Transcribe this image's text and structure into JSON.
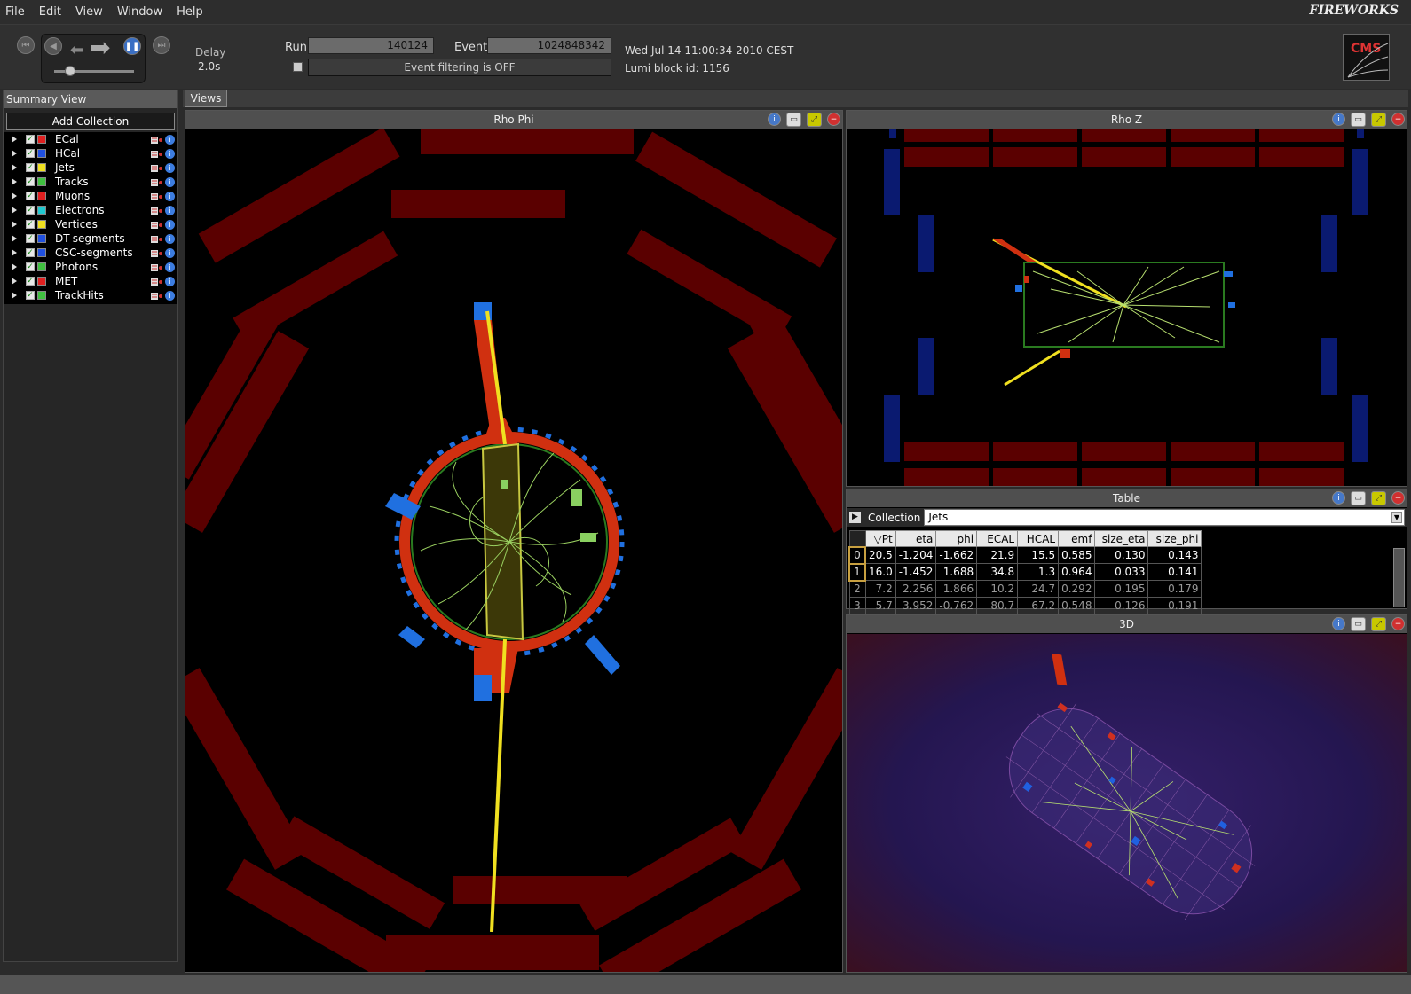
{
  "menu": [
    "File",
    "Edit",
    "View",
    "Window",
    "Help"
  ],
  "brand": "FIREWORKS",
  "toolbar": {
    "delay_label": "Delay",
    "delay_value": "2.0s",
    "run_label": "Run",
    "run_value": "140124",
    "event_label": "Event",
    "event_value": "1024848342",
    "filter_text": "Event filtering is OFF",
    "datetime": "Wed Jul 14 11:00:34 2010 CEST",
    "lumi": "Lumi block id: 1156",
    "cms_logo": "CMS"
  },
  "summary": {
    "title": "Summary View",
    "add_button": "Add Collection",
    "collections": [
      {
        "name": "ECal",
        "color": "#e02020"
      },
      {
        "name": "HCal",
        "color": "#2050e0"
      },
      {
        "name": "Jets",
        "color": "#f0e020"
      },
      {
        "name": "Tracks",
        "color": "#40c040"
      },
      {
        "name": "Muons",
        "color": "#e02020"
      },
      {
        "name": "Electrons",
        "color": "#20c8d0"
      },
      {
        "name": "Vertices",
        "color": "#f0e020"
      },
      {
        "name": "DT-segments",
        "color": "#2050e0"
      },
      {
        "name": "CSC-segments",
        "color": "#2050e0"
      },
      {
        "name": "Photons",
        "color": "#40c040"
      },
      {
        "name": "MET",
        "color": "#e02020"
      },
      {
        "name": "TrackHits",
        "color": "#40c040"
      }
    ]
  },
  "views_tab": "Views",
  "panels": {
    "rhophi": "Rho Phi",
    "rhoz": "Rho Z",
    "table": "Table",
    "three_d": "3D"
  },
  "table": {
    "collection_label": "Collection",
    "collection_value": "Jets",
    "columns": [
      "▽Pt",
      "eta",
      "phi",
      "ECAL",
      "HCAL",
      "emf",
      "size_eta",
      "size_phi"
    ],
    "rows": [
      {
        "idx": "0",
        "cells": [
          "20.5",
          "-1.204",
          "-1.662",
          "21.9",
          "15.5",
          "0.585",
          "0.130",
          "0.143"
        ]
      },
      {
        "idx": "1",
        "cells": [
          "16.0",
          "-1.452",
          "1.688",
          "34.8",
          "1.3",
          "0.964",
          "0.033",
          "0.141"
        ]
      },
      {
        "idx": "2",
        "cells": [
          "7.2",
          "2.256",
          "1.866",
          "10.2",
          "24.7",
          "0.292",
          "0.195",
          "0.179"
        ]
      },
      {
        "idx": "3",
        "cells": [
          "5.7",
          "3.952",
          "-0.762",
          "80.7",
          "67.2",
          "0.548",
          "0.126",
          "0.191"
        ]
      }
    ]
  }
}
